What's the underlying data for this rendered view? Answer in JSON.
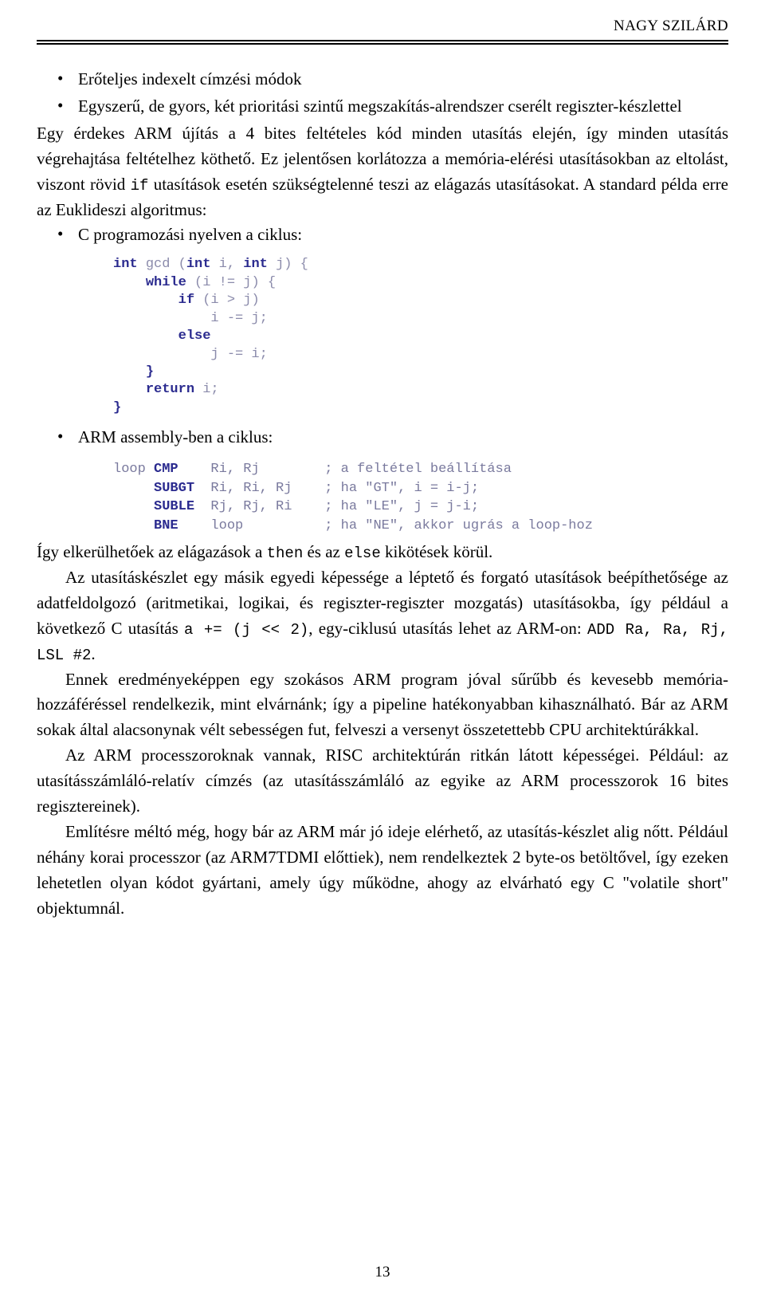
{
  "header": {
    "author": "NAGY SZILÁRD"
  },
  "bullets": [
    "Erőteljes indexelt címzési módok",
    "Egyszerű, de gyors, két prioritási szintű megszakítás-alrendszer cserélt regiszter-készlettel"
  ],
  "body": {
    "p1_part1": "Egy érdekes ARM újítás a 4 bites feltételes kód minden utasítás elején, így minden utasítás végrehajtása feltételhez köthető. Ez jelentősen korlátozza a memória-elérési utasításokban az eltolást, viszont rövid ",
    "p1_if": "if",
    "p1_part2": " utasítások esetén szükségtelenné teszi az elágazás utasításokat. A standard példa erre az Euklideszi algoritmus:",
    "bullet_c": "C programozási nyelven a ciklus:",
    "bullet_asm": "ARM assembly-ben a ciklus:",
    "p2_part1": "Így elkerülhetőek az elágazások a ",
    "p2_then": "then",
    "p2_part2": " és az ",
    "p2_else": "else",
    "p2_part3": " kikötések körül.",
    "p3_part1": "Az utasításkészlet egy másik egyedi képessége a léptető és forgató utasítások beépíthetősége az adatfeldolgozó (aritmetikai, logikai, és regiszter-regiszter mozgatás) utasításokba, így például a következő C utasítás ",
    "p3_code1": "a += (j << 2)",
    "p3_part2": ", egy-ciklusú utasítás lehet az ARM-on: ",
    "p3_code2": "ADD Ra, Ra, Rj, LSL #2",
    "p3_part3": ".",
    "p4": "Ennek eredményeképpen egy szokásos ARM program jóval sűrűbb és kevesebb memória-hozzáféréssel rendelkezik, mint elvárnánk; így a pipeline hatékonyabban kihasználható. Bár az ARM sokak által alacsonynak vélt sebességen fut, felveszi a versenyt összetettebb CPU architektúrákkal.",
    "p5": "Az ARM processzoroknak vannak, RISC architektúrán ritkán látott képességei. Például: az utasításszámláló-relatív címzés (az utasításszámláló az egyike az ARM processzorok 16 bites regisztereinek).",
    "p6": "Említésre méltó még, hogy bár az ARM már jó ideje elérhető, az utasítás-készlet alig nőtt. Például néhány korai processzor (az ARM7TDMI előttiek), nem rendelkeztek 2 byte-os betöltővel, így ezeken lehetetlen olyan kódot gyártani, amely úgy működne, ahogy az elvárható egy C \"volatile short\" objektumnál."
  },
  "code_c": {
    "lines": [
      "int gcd (int i, int j) {",
      "    while (i != j) {",
      "        if (i > j)",
      "            i -= j;",
      "        else",
      "            j -= i;",
      "    }",
      "    return i;",
      "}"
    ]
  },
  "code_asm": {
    "lines": [
      "loop CMP    Ri, Rj        ; a feltétel beállítása",
      "     SUBGT  Ri, Ri, Rj    ; ha \"GT\", i = i-j;",
      "     SUBLE  Rj, Rj, Ri    ; ha \"LE\", j = j-i;",
      "     BNE    loop          ; ha \"NE\", akkor ugrás a loop-hoz"
    ]
  },
  "footer": {
    "page_number": "13"
  }
}
